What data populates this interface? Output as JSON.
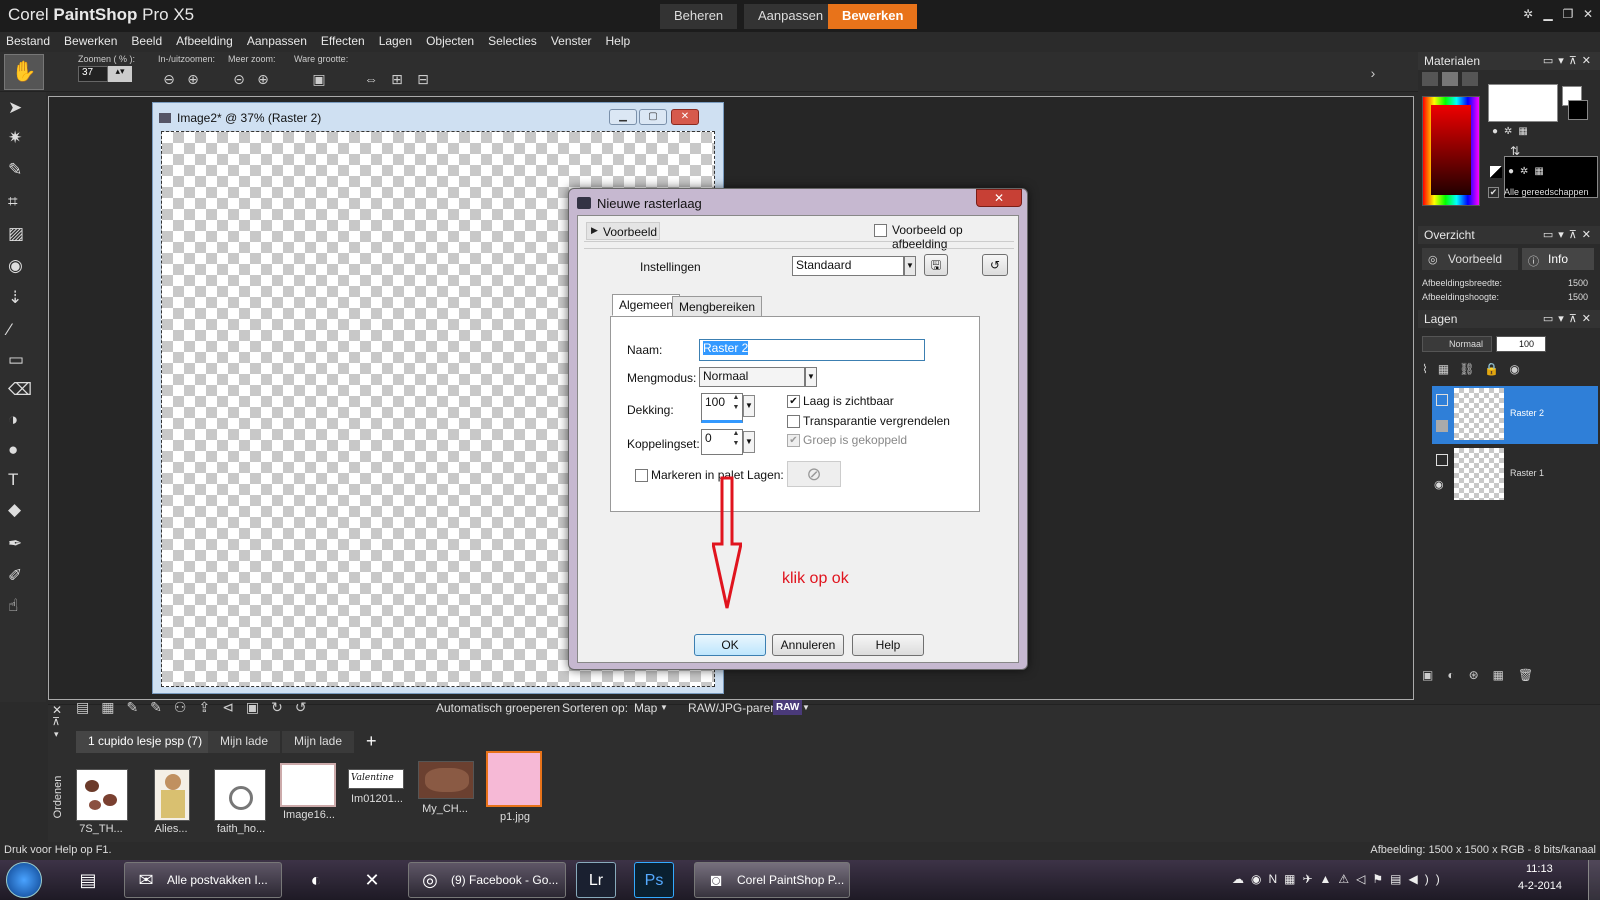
{
  "app": {
    "title_light": "Corel ",
    "title_bold": "PaintShop",
    "title_rest": " Pro X5",
    "workspace_tabs": [
      {
        "label": "Beheren"
      },
      {
        "label": "Aanpassen"
      },
      {
        "label": "Bewerken"
      }
    ]
  },
  "menu": [
    "Bestand",
    "Bewerken",
    "Beeld",
    "Afbeelding",
    "Aanpassen",
    "Effecten",
    "Lagen",
    "Objecten",
    "Selecties",
    "Venster",
    "Help"
  ],
  "toolbar": {
    "zoom_label": "Zoomen ( % ):",
    "zoom_value": "37",
    "inout_label": "In-/uitzoomen:",
    "more_label": "Meer zoom:",
    "actual_label": "Ware grootte:"
  },
  "image_window": {
    "title": "Image2* @  37% (Raster 2)"
  },
  "dialog": {
    "title": "Nieuwe rasterlaag",
    "preview_label": "Voorbeeld",
    "preview_on_image": "Voorbeeld op afbeelding",
    "settings_label": "Instellingen",
    "settings_value": "Standaard",
    "tabs": [
      "Algemeen",
      "Mengbereiken"
    ],
    "name_label": "Naam:",
    "name_value": "Raster 2",
    "blend_label": "Mengmodus:",
    "blend_value": "Normaal",
    "opacity_label": "Dekking:",
    "opacity_value": "100",
    "linkset_label": "Koppelingset:",
    "linkset_value": "0",
    "visible_label": "Laag is zichtbaar",
    "lock_transp_label": "Transparantie vergrendelen",
    "group_linked_label": "Groep is gekoppeld",
    "highlight_label": "Markeren in palet Lagen:",
    "ok": "OK",
    "cancel": "Annuleren",
    "help": "Help"
  },
  "annotation": {
    "text": "klik op ok",
    "color": "#e0141e"
  },
  "panels": {
    "materials_title": "Materialen",
    "all_tools": "Alle gereedschappen",
    "overview_title": "Overzicht",
    "preview_tab": "Voorbeeld",
    "info_tab": "Info",
    "width_label": "Afbeeldingsbreedte:",
    "width_value": "1500",
    "height_label": "Afbeeldingshoogte:",
    "height_value": "1500",
    "layers_title": "Lagen",
    "layers_blend": "Normaal",
    "layers_opacity": "100",
    "layers": [
      {
        "name": "Raster 2",
        "selected": true
      },
      {
        "name": "Raster 1",
        "selected": false
      }
    ]
  },
  "organizer": {
    "auto_group": "Automatisch groeperen",
    "sort_label": "Sorteren op:",
    "sort_value": "Map",
    "raw_label": "RAW/JPG-paren:",
    "raw_badge": "RAW",
    "side_label": "Ordenen",
    "tabs": [
      "1 cupido lesje psp (7)",
      "Mijn lade",
      "Mijn lade"
    ],
    "add_tab": "+",
    "thumbs": [
      {
        "label": "7S_TH..."
      },
      {
        "label": "Alies..."
      },
      {
        "label": "faith_ho..."
      },
      {
        "label": "Image16..."
      },
      {
        "label": "Im01201..."
      },
      {
        "label": "My_CH..."
      },
      {
        "label": "p1.jpg"
      }
    ],
    "valentine_text": "Valentine"
  },
  "status": {
    "left": "Druk voor Help op F1.",
    "right": "Afbeelding:  1500 x 1500 x RGB - 8 bits/kanaal"
  },
  "taskbar": {
    "items": [
      {
        "label": "Alle postvakken I..."
      },
      {
        "label": ""
      },
      {
        "label": ""
      },
      {
        "label": "(9) Facebook - Go..."
      },
      {
        "label": "Lr"
      },
      {
        "label": "Ps"
      },
      {
        "label": "Corel PaintShop P..."
      }
    ],
    "time": "11:13",
    "date": "4-2-2014"
  }
}
